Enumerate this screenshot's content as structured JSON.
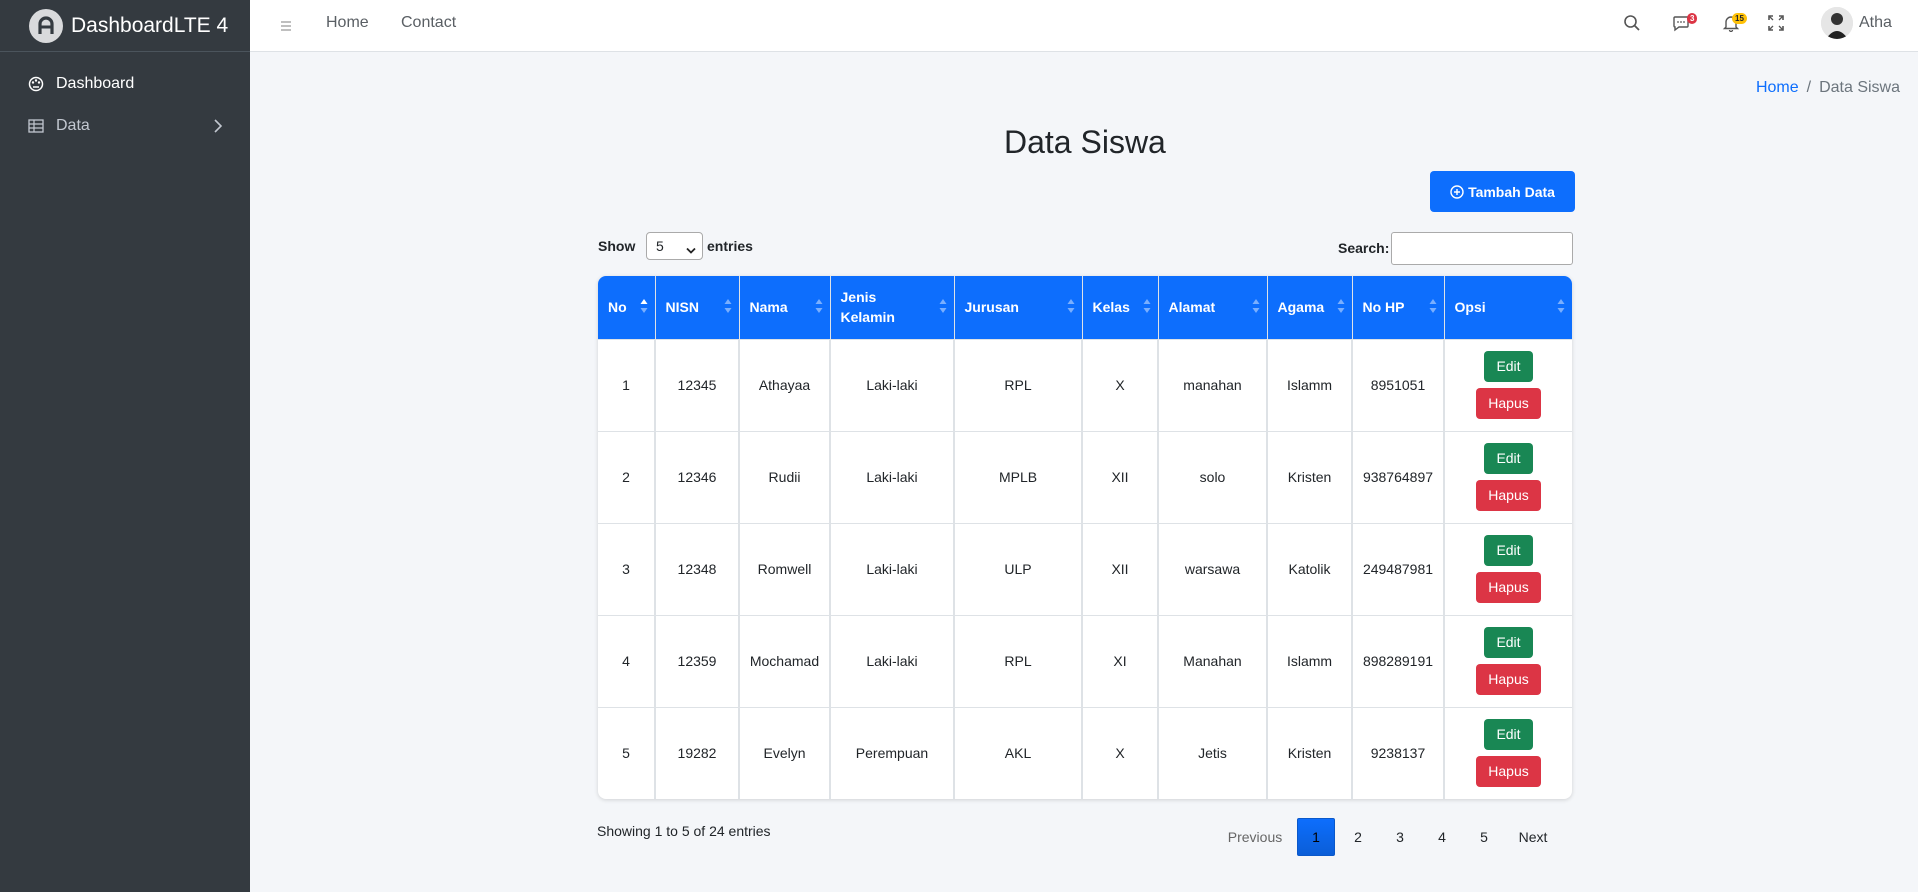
{
  "brand": {
    "title": "DashboardLTE 4"
  },
  "sidebar": {
    "items": [
      {
        "label": "Dashboard",
        "icon": "palette-icon"
      },
      {
        "label": "Data",
        "icon": "table-icon"
      }
    ]
  },
  "topbar": {
    "links": [
      "Home",
      "Contact"
    ],
    "messages_count": "3",
    "notifications_count": "15",
    "user_name": "Atha"
  },
  "breadcrumb": {
    "home": "Home",
    "sep": "/",
    "current": "Data Siswa"
  },
  "page": {
    "title": "Data Siswa",
    "add_button": "Tambah Data"
  },
  "controls": {
    "show_label": "Show",
    "page_size": "5",
    "entries_label": "entries",
    "search_label": "Search:",
    "search_value": ""
  },
  "table": {
    "columns": [
      "No",
      "NISN",
      "Nama",
      "Jenis Kelamin",
      "Jurusan",
      "Kelas",
      "Alamat",
      "Agama",
      "No HP",
      "Opsi"
    ],
    "rows": [
      [
        "1",
        "12345",
        "Athayaa",
        "Laki-laki",
        "RPL",
        "X",
        "manahan",
        "Islamm",
        "8951051"
      ],
      [
        "2",
        "12346",
        "Rudii",
        "Laki-laki",
        "MPLB",
        "XII",
        "solo",
        "Kristen",
        "938764897"
      ],
      [
        "3",
        "12348",
        "Romwell",
        "Laki-laki",
        "ULP",
        "XII",
        "warsawa",
        "Katolik",
        "249487981"
      ],
      [
        "4",
        "12359",
        "Mochamad",
        "Laki-laki",
        "RPL",
        "XI",
        "Manahan",
        "Islamm",
        "898289191"
      ],
      [
        "5",
        "19282",
        "Evelyn",
        "Perempuan",
        "AKL",
        "X",
        "Jetis",
        "Kristen",
        "9238137"
      ]
    ],
    "edit_label": "Edit",
    "delete_label": "Hapus"
  },
  "footer": {
    "info": "Showing 1 to 5 of 24 entries",
    "prev": "Previous",
    "pages": [
      "1",
      "2",
      "3",
      "4",
      "5"
    ],
    "current_page": "1",
    "next": "Next"
  },
  "colors": {
    "primary": "#0d6efd",
    "success": "#198754",
    "danger": "#dc3545",
    "sidebar": "#343a40"
  }
}
